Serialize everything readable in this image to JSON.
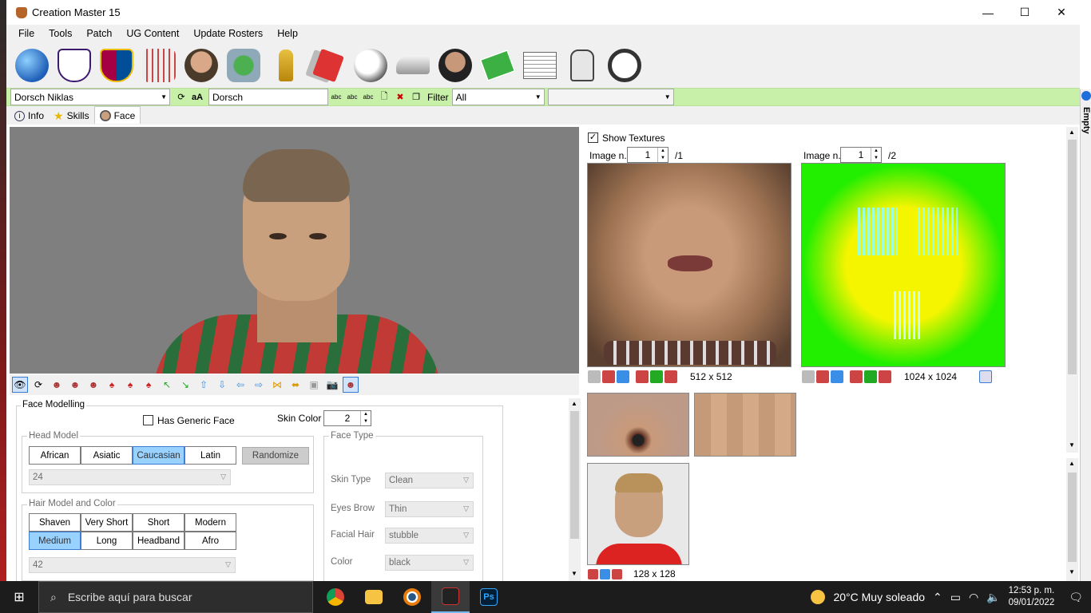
{
  "window": {
    "title": "Creation Master 15",
    "minimize": "—",
    "maximize": "☐",
    "close": "✕"
  },
  "menu": [
    "File",
    "Tools",
    "Patch",
    "UG Content",
    "Update Rosters",
    "Help"
  ],
  "toolbar_icons": [
    "globe-icon",
    "premier-league-icon",
    "barcelona-crest-icon",
    "jersey-icon",
    "player-icon",
    "stadium-icon",
    "world-cup-trophy-icon",
    "cards-icon",
    "ball-icon",
    "boots-icon",
    "manager-icon",
    "pitch-icon",
    "newspaper-icon",
    "gloves-icon",
    "headphones-icon"
  ],
  "filter": {
    "player": "Dorsch Niklas",
    "search_text": "Dorsch",
    "filter_label": "Filter",
    "filter_value": "All",
    "aa_label": "aA",
    "abc": "abc",
    "side_tab": "Empty"
  },
  "tabs": [
    "Info",
    "Skills",
    "Face"
  ],
  "face": {
    "panel_title": "Face Modelling",
    "generic_face": "Has Generic Face",
    "skin_color_label": "Skin Color",
    "skin_color": "2",
    "head_model": {
      "title": "Head Model",
      "options": [
        "African",
        "Asiatic",
        "Caucasian",
        "Latin"
      ],
      "selected": "Caucasian",
      "randomize": "Randomize",
      "value": "24"
    },
    "hair": {
      "title": "Hair Model and Color",
      "row1": [
        "Shaven",
        "Very Short",
        "Short",
        "Modern"
      ],
      "row2": [
        "Medium",
        "Long",
        "Headband",
        "Afro"
      ],
      "selected": "Medium",
      "value": "42"
    },
    "face_type": {
      "title": "Face Type",
      "skin_type_label": "Skin Type",
      "skin_type": "Clean",
      "eyes_brow_label": "Eyes Brow",
      "eyes_brow": "Thin",
      "facial_hair_label": "Facial Hair",
      "facial_hair": "stubble",
      "color_label": "Color",
      "color": "black"
    }
  },
  "textures": {
    "show_label": "Show Textures",
    "image_label": "Image n.",
    "left": {
      "index": "1",
      "total": "/1",
      "size": "512 x 512"
    },
    "right": {
      "index": "1",
      "total": "/2",
      "size": "1024 x 1024"
    },
    "photo_size": "128 x 128"
  },
  "taskbar": {
    "search_placeholder": "Escribe aquí para buscar",
    "weather": "20°C  Muy soleado",
    "time": "12:53 p. m.",
    "date": "09/01/2022"
  },
  "colors": {
    "accent_filter": "#c8f0a8",
    "selected_button": "#99d1ff",
    "texture_green": "#22ee00",
    "texture_yellow": "#f5f500"
  }
}
